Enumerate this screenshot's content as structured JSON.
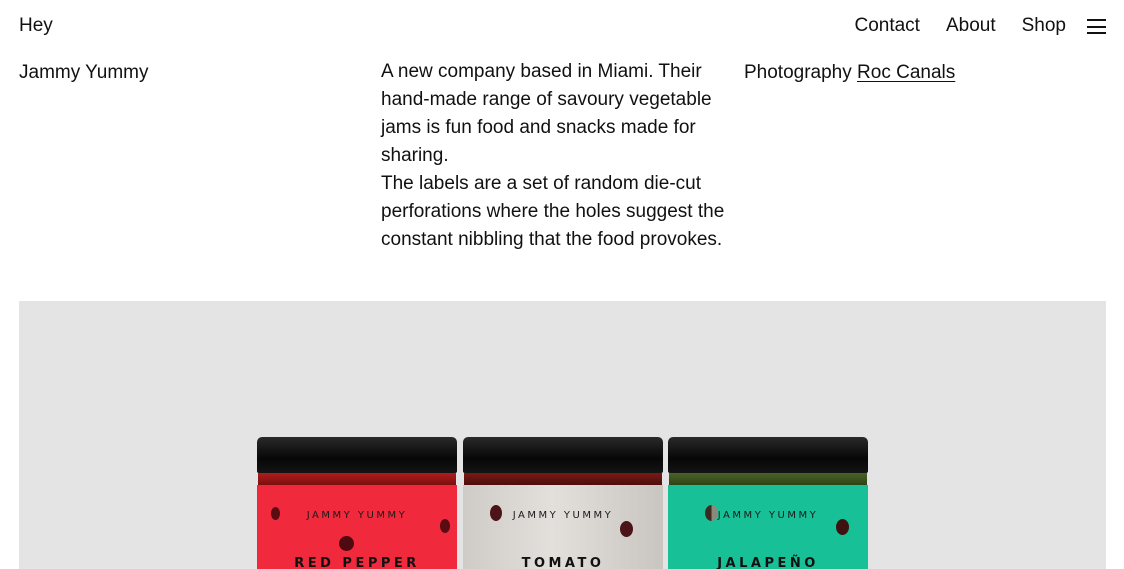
{
  "header": {
    "brand": "Hey",
    "nav": [
      "Contact",
      "About",
      "Shop"
    ],
    "menu_icon": "hamburger-menu-icon"
  },
  "project": {
    "title": "Jammy Yummy",
    "description": [
      "A new company based in Miami. Their hand-made range of savoury vegetable jams is fun food and snacks made for sharing.",
      "The labels are a set of random die-cut perforations where the holes suggest the constant nibbling that the food provokes."
    ],
    "credit_label": "Photography",
    "credit_name": "Roc Canals"
  },
  "hero": {
    "background": "#e4e4e4",
    "jars": [
      {
        "brand": "JAMMY YUMMY",
        "product": "RED PEPPER",
        "label_color": "#f02a3c",
        "rim_color": "#8e1414"
      },
      {
        "brand": "JAMMY YUMMY",
        "product": "TOMATO",
        "label_color": "#d7d3cf",
        "rim_color": "#5c1414"
      },
      {
        "brand": "JAMMY YUMMY",
        "product": "JALAPEÑO",
        "label_color": "#17c097",
        "rim_color": "#3f5a21"
      }
    ]
  }
}
